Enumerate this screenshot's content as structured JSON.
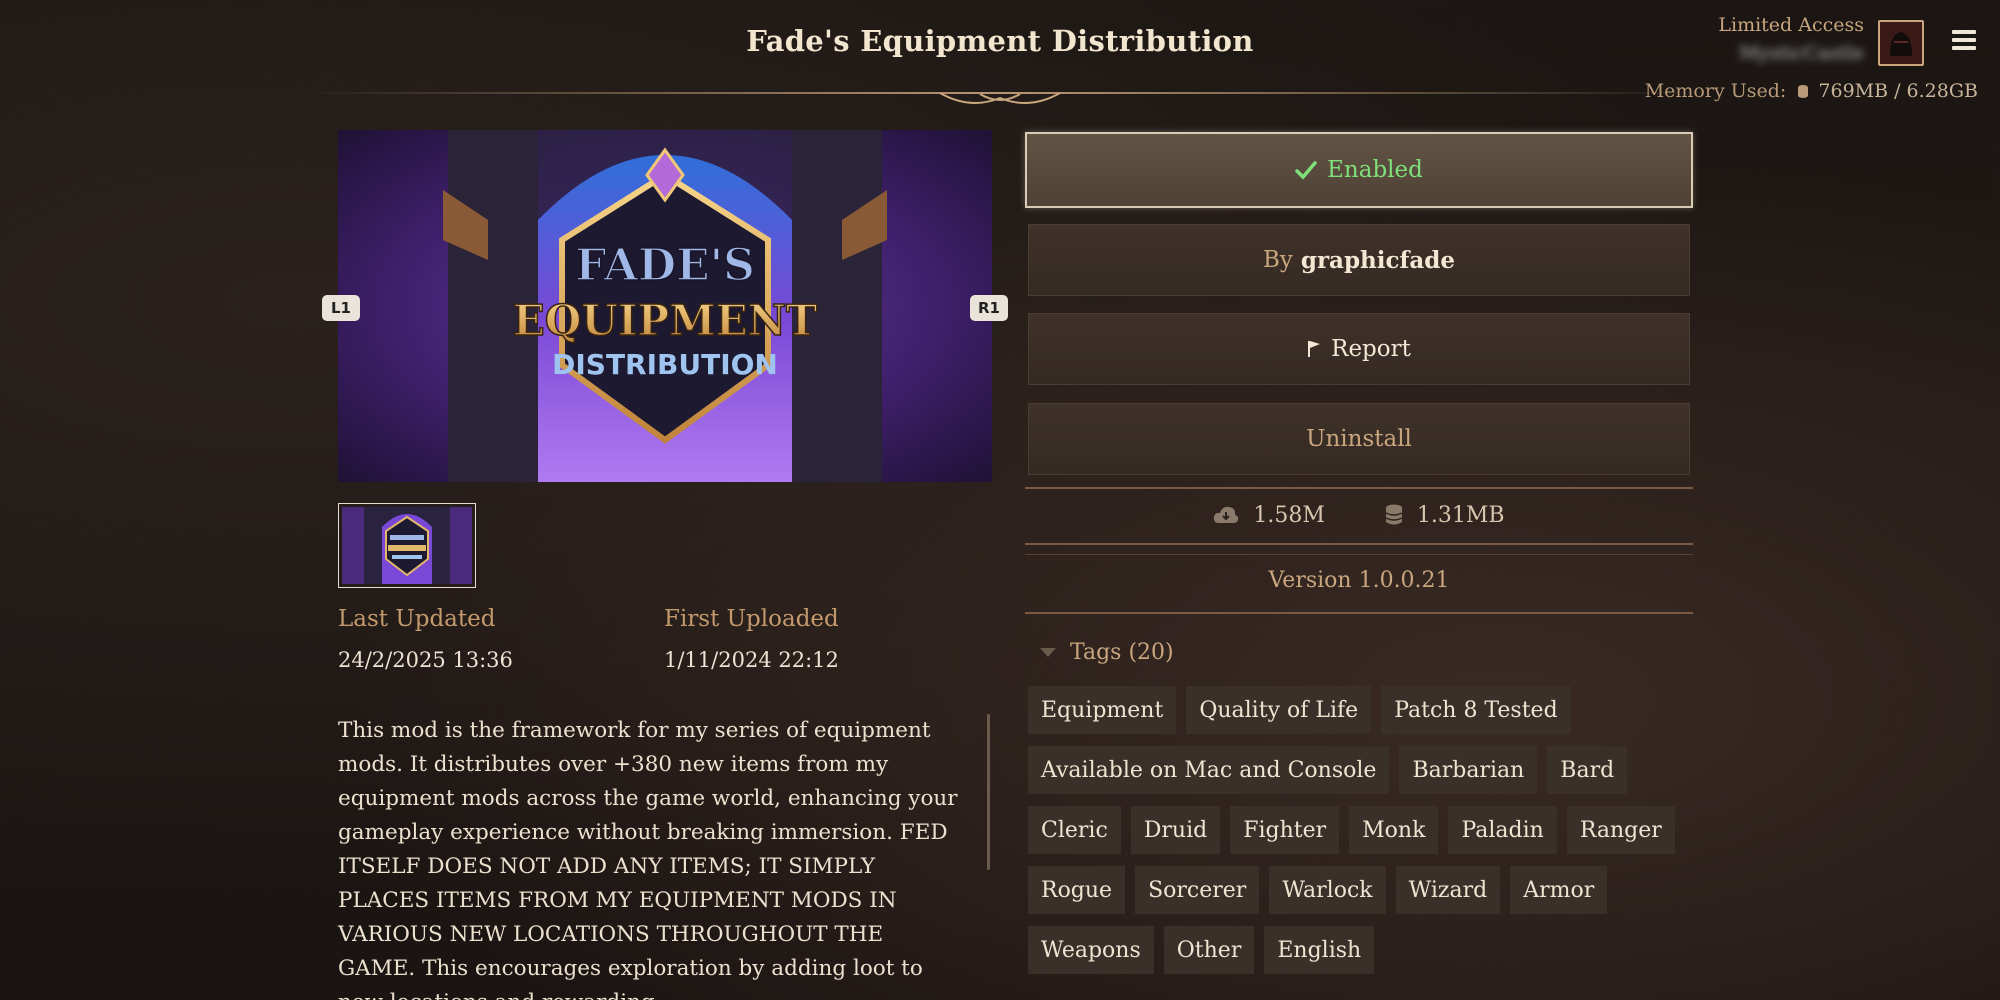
{
  "header": {
    "title": "Fade's Equipment Distribution",
    "limited_access": "Limited Access",
    "username": "MysticCastle",
    "memory_label": "Memory Used:",
    "memory_value": "769MB / 6.28GB"
  },
  "gallery": {
    "prev_label": "L1",
    "next_label": "R1",
    "hero_logo_line1": "FADE'S",
    "hero_logo_line2": "EQUIPMENT",
    "hero_logo_line3": "DISTRIBUTION"
  },
  "meta": {
    "last_updated_label": "Last Updated",
    "last_updated_value": "24/2/2025 13:36",
    "first_uploaded_label": "First Uploaded",
    "first_uploaded_value": "1/11/2024 22:12"
  },
  "description": "This mod is the framework for my series of equipment mods. It distributes over +380 new items from my equipment mods across the game world, enhancing your gameplay experience without breaking immersion. FED ITSELF DOES NOT ADD ANY ITEMS; IT SIMPLY PLACES ITEMS FROM MY EQUIPMENT MODS IN VARIOUS NEW LOCATIONS THROUGHOUT THE GAME. This encourages exploration by adding loot to new locations and rewarding",
  "actions": {
    "enabled_label": "Enabled",
    "by_prefix": "By",
    "author": "graphicfade",
    "report_label": "Report",
    "uninstall_label": "Uninstall"
  },
  "stats": {
    "downloads": "1.58M",
    "size": "1.31MB"
  },
  "version": "Version 1.0.0.21",
  "tags": {
    "header": "Tags (20)",
    "items": [
      "Equipment",
      "Quality of Life",
      "Patch 8 Tested",
      "Available on Mac and Console",
      "Barbarian",
      "Bard",
      "Cleric",
      "Druid",
      "Fighter",
      "Monk",
      "Paladin",
      "Ranger",
      "Rogue",
      "Sorcerer",
      "Warlock",
      "Wizard",
      "Armor",
      "Weapons",
      "Other",
      "English"
    ]
  },
  "colors": {
    "accent_gold": "#c9a67e",
    "enabled_green": "#7fe07a",
    "tag_bg": "#3a302a"
  },
  "icons": [
    "menu-icon",
    "check-icon",
    "flag-icon",
    "cloud-download-icon",
    "database-icon",
    "triangle-down-icon"
  ]
}
